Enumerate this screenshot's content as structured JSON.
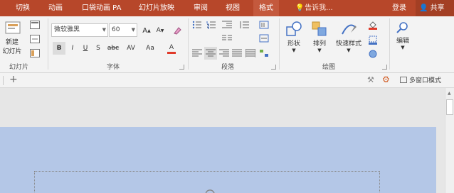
{
  "tabs": {
    "transitions": "切换",
    "animations": "动画",
    "pocket": "口袋动画 PA",
    "slideshow": "幻灯片放映",
    "review": "审阅",
    "view": "视图",
    "format": "格式"
  },
  "tell_me": "告诉我...",
  "login": "登录",
  "share": "共享",
  "slides_group": {
    "new_slide": "新建",
    "new_slide_sub": "幻灯片",
    "label": "幻灯片"
  },
  "font_group": {
    "font_name": "微软雅黑",
    "font_size": "60",
    "bold": "B",
    "italic": "I",
    "underline": "U",
    "shadow": "S",
    "strike": "abc",
    "spacing": "AV",
    "case": "Aa",
    "color": "A",
    "label": "字体"
  },
  "paragraph_group": {
    "label": "段落"
  },
  "drawing_group": {
    "shapes": "形状",
    "arrange": "排列",
    "quick_styles": "快速样式",
    "label": "绘图"
  },
  "editing_group": {
    "edit": "编辑"
  },
  "strip": {
    "add": "+",
    "multi_window": "多窗口模式"
  },
  "colors": {
    "accent": "#b7472a",
    "slide": "#b4c7e7",
    "font_color": "#e03a2a"
  }
}
